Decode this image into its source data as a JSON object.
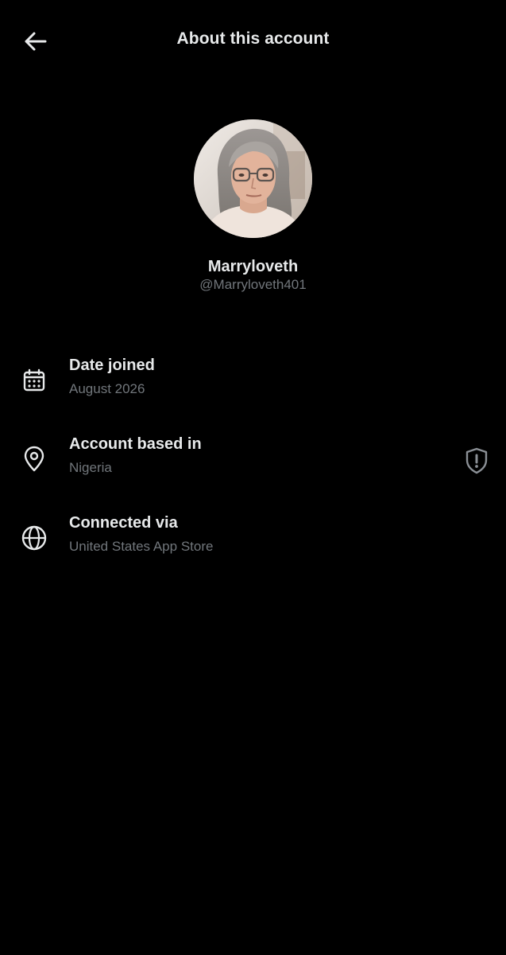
{
  "header": {
    "title": "About this account",
    "back_icon": "arrow-left-icon"
  },
  "profile": {
    "display_name": "Marryloveth",
    "handle": "@Marryloveth401"
  },
  "info_rows": [
    {
      "icon": "calendar-icon",
      "label": "Date joined",
      "value": "August 2026"
    },
    {
      "icon": "location-pin-icon",
      "label": "Account based in",
      "value": "Nigeria",
      "trailing_icon": "shield-alert-icon"
    },
    {
      "icon": "globe-icon",
      "label": "Connected via",
      "value": "United States App Store"
    }
  ],
  "colors": {
    "background": "#000000",
    "primary_text": "#e7e9ea",
    "secondary_text": "#71767b"
  }
}
